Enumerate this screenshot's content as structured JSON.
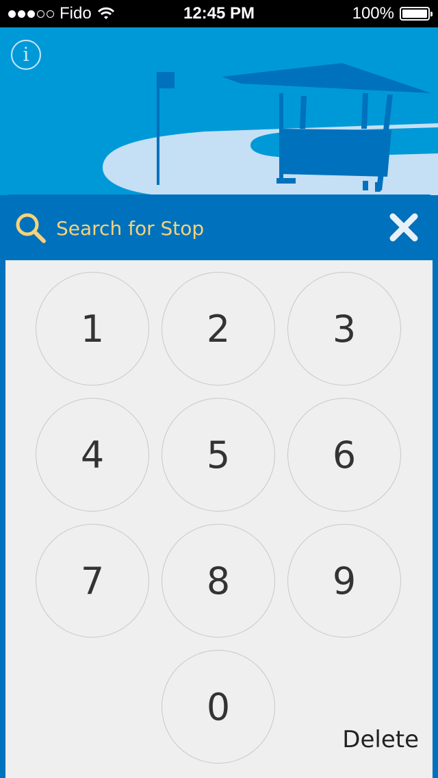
{
  "status_bar": {
    "carrier": "Fido",
    "time": "12:45 PM",
    "battery": "100%",
    "signal_icon": "signal-dots-icon",
    "wifi_icon": "wifi-icon",
    "battery_icon": "battery-icon"
  },
  "header": {
    "info_label": "i",
    "illustration": "bus-shelter-illustration"
  },
  "search": {
    "placeholder": "Search for Stop",
    "value": "",
    "search_icon": "search-icon",
    "close_icon": "close-icon"
  },
  "keypad": {
    "keys": [
      "1",
      "2",
      "3",
      "4",
      "5",
      "6",
      "7",
      "8",
      "9",
      "0"
    ],
    "delete_label": "Delete"
  },
  "colors": {
    "header_bg": "#0099d8",
    "panel_bg": "#0071bc",
    "accent": "#f6d37a",
    "keypad_bg": "#efefef"
  }
}
